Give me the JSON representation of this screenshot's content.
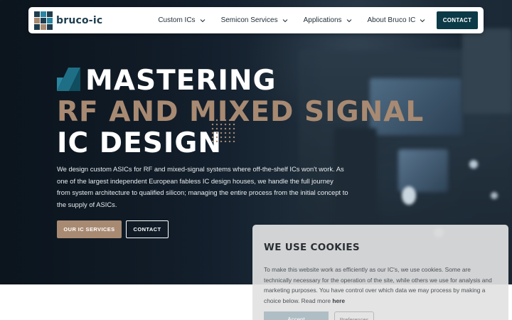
{
  "brand": {
    "name": "bruco-ic",
    "colors": {
      "navy": "#0c3a47",
      "tan": "#a88a72",
      "logo_blue": "#1d3d4e"
    }
  },
  "nav": {
    "items": [
      {
        "label": "Custom ICs",
        "icon": "chevron-down-icon"
      },
      {
        "label": "Semicon Services",
        "icon": "chevron-down-icon"
      },
      {
        "label": "Applications",
        "icon": "chevron-down-icon"
      },
      {
        "label": "About Bruco IC",
        "icon": "chevron-down-icon"
      }
    ],
    "contact_label": "CONTACT"
  },
  "hero": {
    "line1": "MASTERING",
    "line2": "RF AND MIXED SIGNAL",
    "line3": "IC DESIGN",
    "intro": "We design custom ASICs for RF and mixed-signal systems where off-the-shelf ICs won't work. As one of the largest independent European fabless IC design houses, we handle the full journey from system architecture to qualified silicon; managing the entire process from the initial concept to the supply of ASICs.",
    "primary_button": "OUR IC SERVICES",
    "secondary_button": "CONTACT"
  },
  "cookie": {
    "title": "WE USE COOKIES",
    "text": "To make this website work as efficiently as our IC's, we use cookies. Some are technically necessary for the operation of the site, while others we use for analysis and marketing purposes. You have control over which data we may process by making a choice below. Read more",
    "link": "here",
    "accept": "Accept",
    "preferences": "Preferences"
  }
}
